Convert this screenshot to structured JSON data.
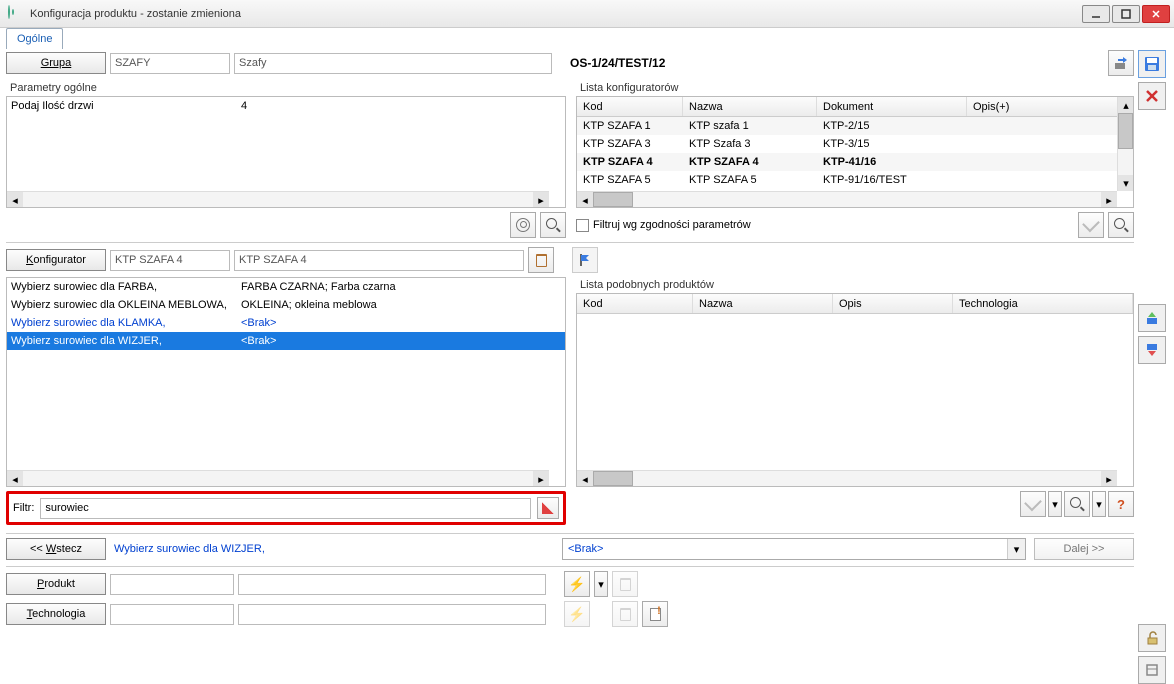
{
  "window": {
    "title": "Konfiguracja produktu - zostanie zmieniona"
  },
  "tabs": {
    "general": "Ogólne"
  },
  "group": {
    "button": "Grupa",
    "code": "SZAFY",
    "name": "Szafy"
  },
  "general_params": {
    "label": "Parametry ogólne",
    "row1_label": "Podaj Ilość drzwi",
    "row1_value": "4"
  },
  "section_code": "OS-1/24/TEST/12",
  "configurators": {
    "label": "Lista konfiguratorów",
    "th_kod": "Kod",
    "th_nazwa": "Nazwa",
    "th_dokument": "Dokument",
    "th_opis": "Opis(+)",
    "rows": [
      {
        "kod": "KTP SZAFA 1",
        "nazwa": "KTP szafa 1",
        "dok": "KTP-2/15",
        "bold": false
      },
      {
        "kod": "KTP SZAFA 3",
        "nazwa": "KTP Szafa 3",
        "dok": "KTP-3/15",
        "bold": false
      },
      {
        "kod": "KTP SZAFA 4",
        "nazwa": "KTP SZAFA 4",
        "dok": "KTP-41/16",
        "bold": true
      },
      {
        "kod": "KTP SZAFA 5",
        "nazwa": "KTP SZAFA 5",
        "dok": "KTP-91/16/TEST",
        "bold": false
      }
    ],
    "filter_checkbox": "Filtruj wg zgodności parametrów"
  },
  "configurator": {
    "button": "Konfigurator",
    "code": "KTP SZAFA 4",
    "name": "KTP SZAFA 4"
  },
  "materials": {
    "rows": [
      {
        "label": "Wybierz surowiec dla FARBA,",
        "value": "FARBA CZARNA; Farba czarna",
        "blue": false,
        "sel": false
      },
      {
        "label": "Wybierz surowiec dla OKLEINA MEBLOWA,",
        "value": "OKLEINA; okleina meblowa",
        "blue": false,
        "sel": false
      },
      {
        "label": "Wybierz surowiec dla KLAMKA,",
        "value": "<Brak>",
        "blue": true,
        "sel": false
      },
      {
        "label": "Wybierz surowiec dla WIZJER,",
        "value": "<Brak>",
        "blue": true,
        "sel": true
      }
    ]
  },
  "similar": {
    "label": "Lista podobnych produktów",
    "th_kod": "Kod",
    "th_nazwa": "Nazwa",
    "th_opis": "Opis",
    "th_tech": "Technologia"
  },
  "filter": {
    "label": "Filtr:",
    "value": "surowiec"
  },
  "nav": {
    "back": "<< Wstecz",
    "current_param": "Wybierz surowiec dla WIZJER,",
    "value": "<Brak>",
    "next": "Dalej >>"
  },
  "bottom": {
    "product": "Produkt",
    "technology": "Technologia"
  }
}
